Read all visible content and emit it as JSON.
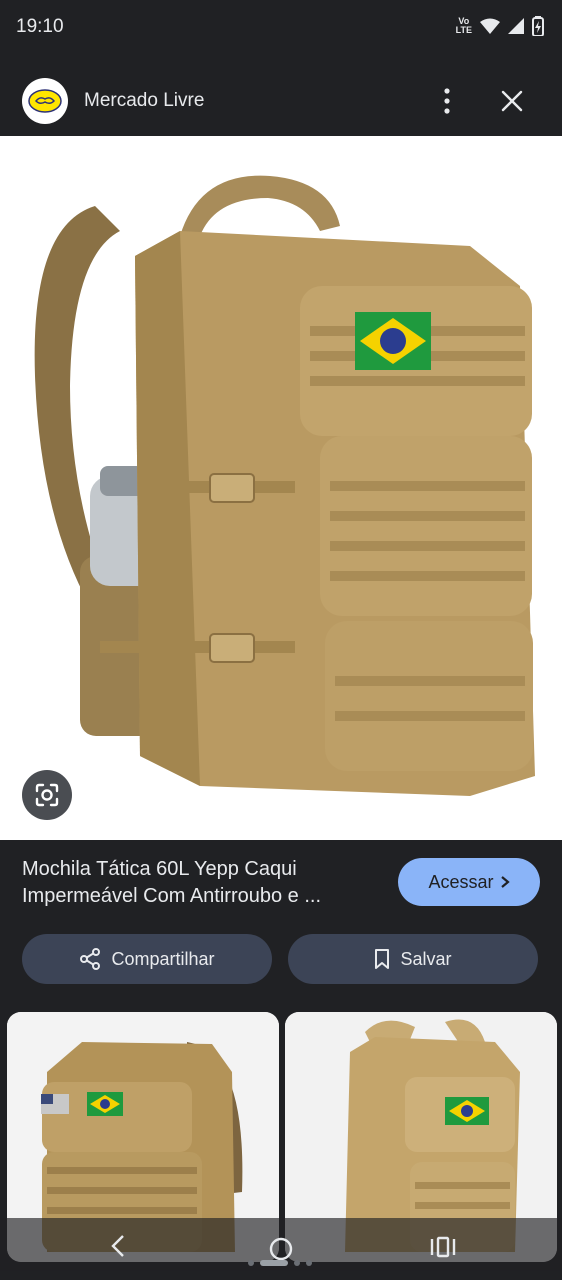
{
  "status": {
    "time": "19:10",
    "network_top": "Vo",
    "network_bottom": "LTE"
  },
  "header": {
    "app_name": "Mercado Livre"
  },
  "product": {
    "title_line1": "Mochila Tática 60L Yepp Caqui",
    "title_line2": "Impermeável Com Antirroubo e ...",
    "visit_label": "Acessar"
  },
  "actions": {
    "share_label": "Compartilhar",
    "save_label": "Salvar"
  },
  "colors": {
    "accent": "#8ab4f8",
    "background": "#202124",
    "pill": "#3c4456",
    "backpack": "#b99a62"
  }
}
